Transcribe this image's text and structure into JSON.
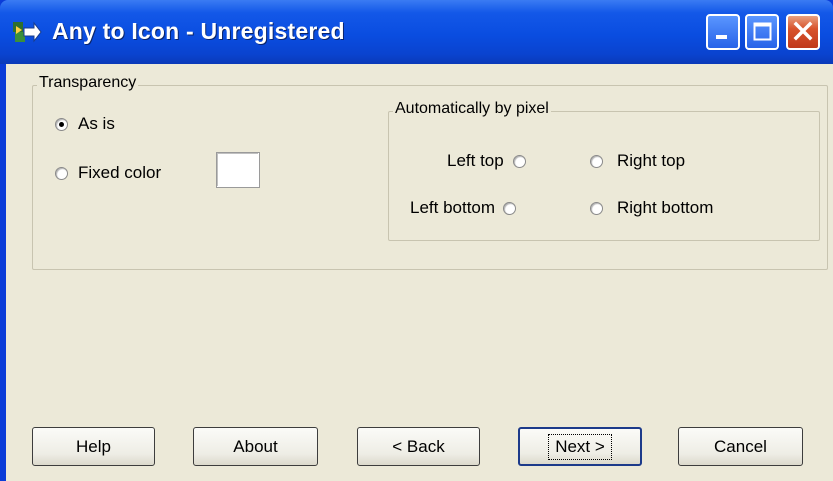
{
  "window": {
    "title": "Any to Icon - Unregistered"
  },
  "transparency": {
    "title": "Transparency",
    "as_is": {
      "label": "As is",
      "checked": true
    },
    "fixed_color": {
      "label": "Fixed color",
      "checked": false,
      "color": "#ffffff"
    }
  },
  "auto_pixel": {
    "title": "Automatically by pixel",
    "left_top": "Left top",
    "right_top": "Right top",
    "left_bottom": "Left bottom",
    "right_bottom": "Right bottom"
  },
  "buttons": {
    "help": "Help",
    "about": "About",
    "back": "< Back",
    "next": "Next >",
    "cancel": "Cancel"
  },
  "colors": {
    "titlebar": "#0a4de0",
    "dialog_bg": "#ece9d8",
    "close_button": "#d8532c"
  }
}
